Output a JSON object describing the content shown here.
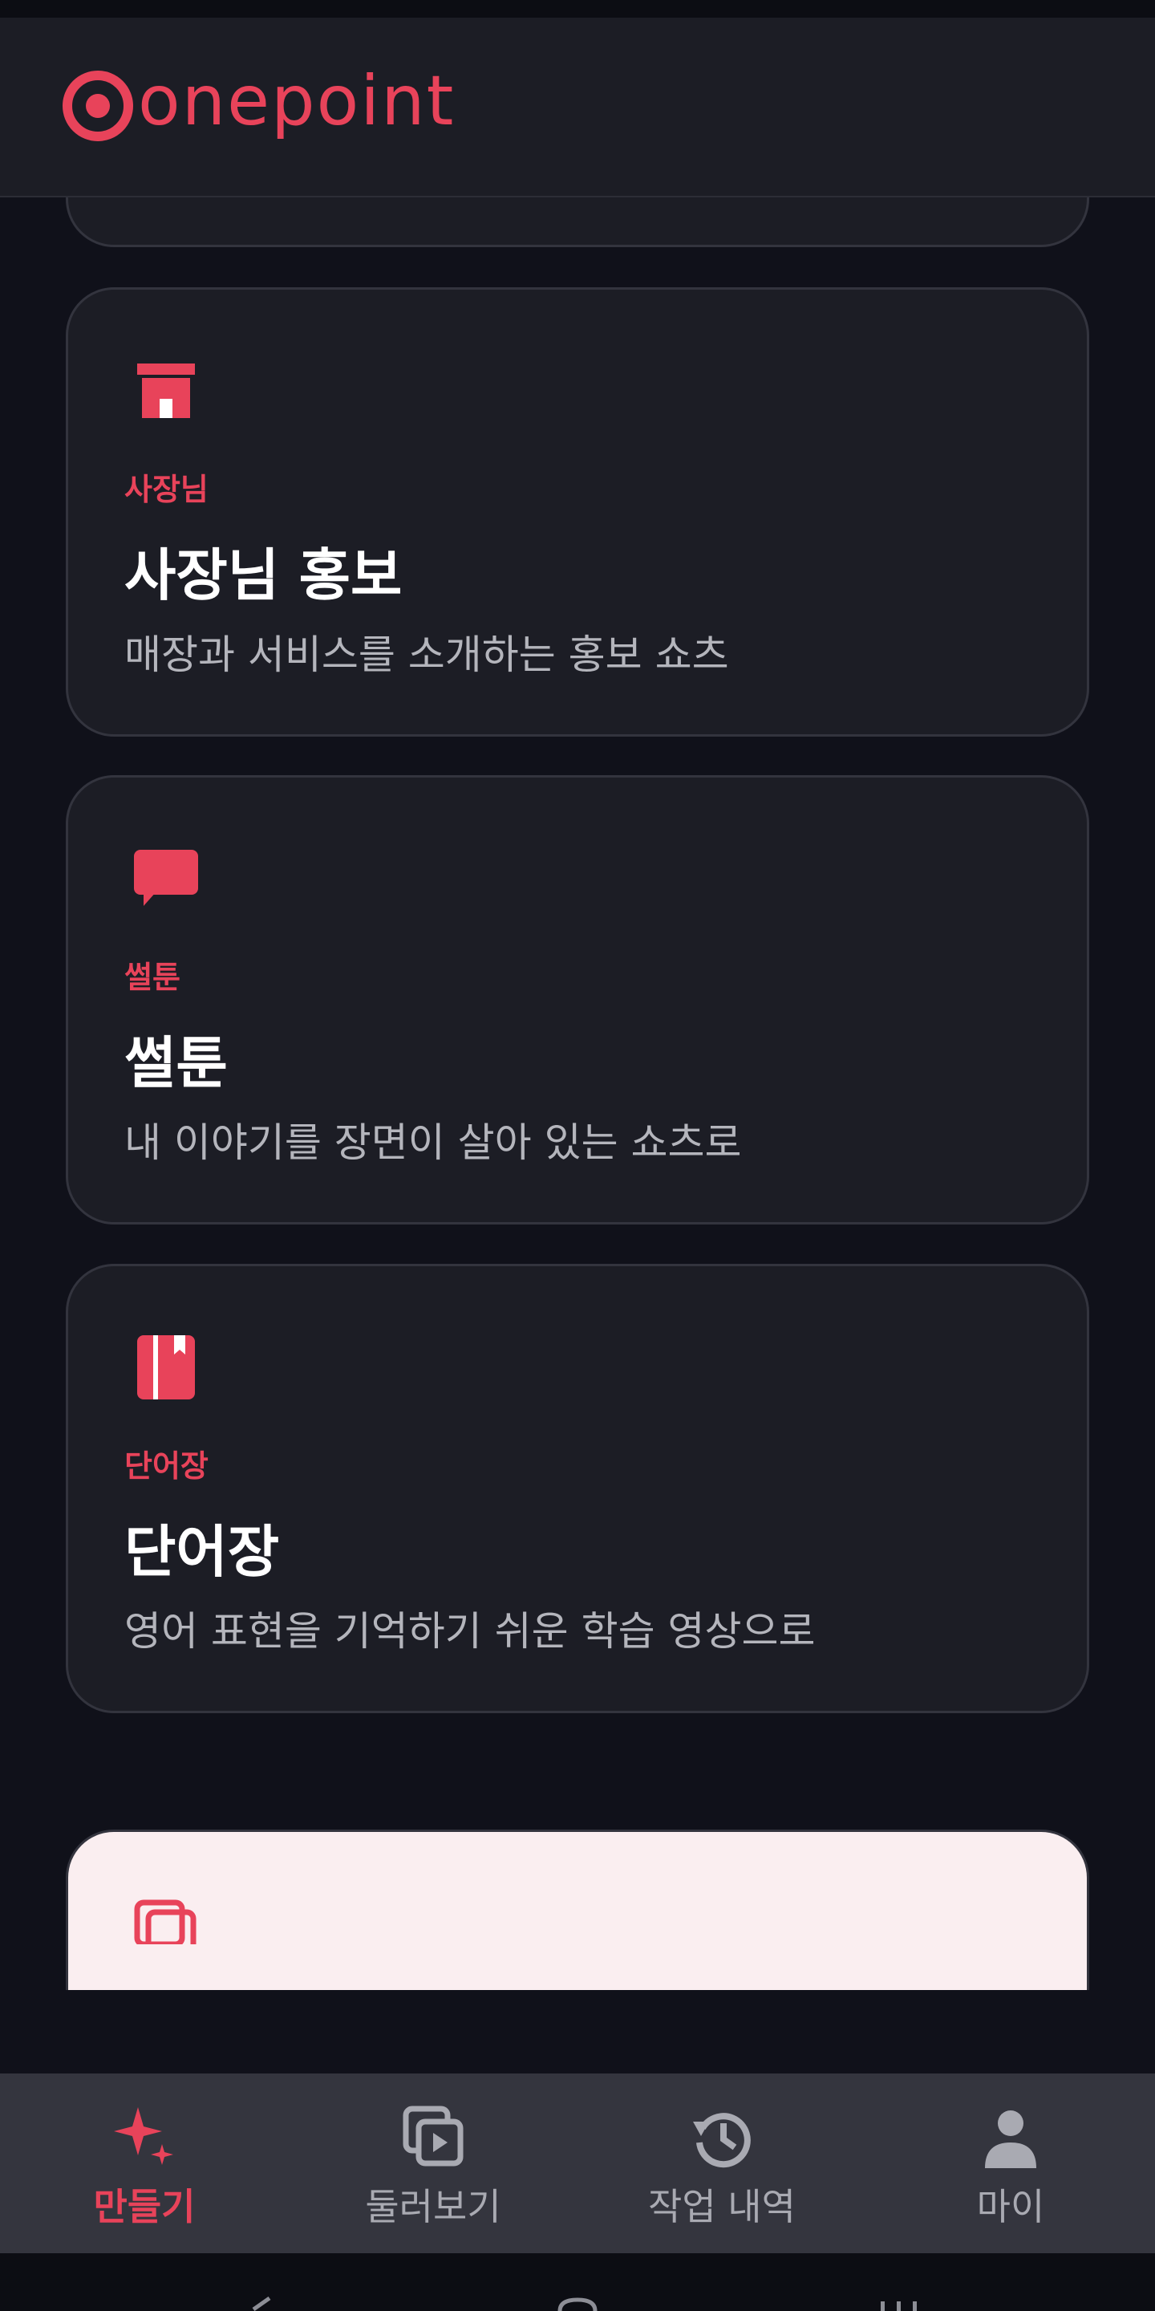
{
  "app": {
    "brand": "onepoint",
    "accent_color": "#e8435a"
  },
  "cards": [
    {
      "icon": "store-icon",
      "tag": "사장님",
      "title": "사장님 홍보",
      "description": "매장과 서비스를 소개하는 홍보 쇼츠"
    },
    {
      "icon": "chat-bubble-icon",
      "tag": "썰툰",
      "title": "썰툰",
      "description": "내 이야기를 장면이 살아 있는 쇼츠로"
    },
    {
      "icon": "book-icon",
      "tag": "단어장",
      "title": "단어장",
      "description": "영어 표현을 기억하기 쉬운 학습 영상으로"
    }
  ],
  "bottom_nav": {
    "items": [
      {
        "label": "만들기",
        "icon": "sparkle-icon",
        "active": true
      },
      {
        "label": "둘러보기",
        "icon": "gallery-play-icon",
        "active": false
      },
      {
        "label": "작업 내역",
        "icon": "history-icon",
        "active": false
      },
      {
        "label": "마이",
        "icon": "person-icon",
        "active": false
      }
    ]
  }
}
